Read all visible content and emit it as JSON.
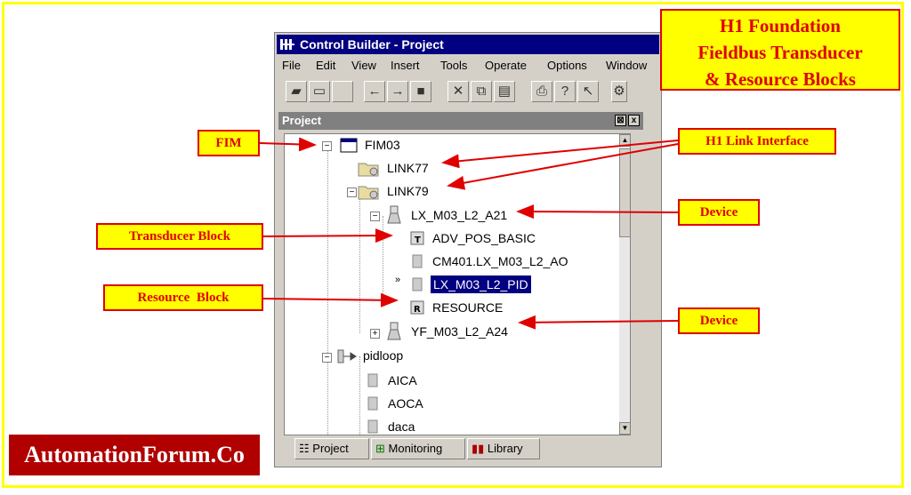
{
  "window": {
    "title": "Control Builder - Project",
    "menu": [
      "File",
      "Edit",
      "View",
      "Insert",
      "Tools",
      "Operate",
      "Options",
      "Window"
    ]
  },
  "panel": {
    "title": "Project",
    "pin_button": "⊠",
    "close_button": "x"
  },
  "tree": [
    {
      "label": "FIM03",
      "expander": "−",
      "icon": "fim-icon"
    },
    {
      "label": "LINK77",
      "expander": "",
      "icon": "link-folder-icon"
    },
    {
      "label": "LINK79",
      "expander": "−",
      "icon": "link-folder-icon"
    },
    {
      "label": "LX_M03_L2_A21",
      "expander": "−",
      "icon": "device-icon"
    },
    {
      "label": "ADV_POS_BASIC",
      "expander": "",
      "icon": "transducer-block-icon",
      "badge": "T"
    },
    {
      "label": "CM401.LX_M03_L2_AO",
      "expander": "",
      "icon": "block-icon"
    },
    {
      "label": "LX_M03_L2_PID",
      "expander": "",
      "icon": "block-icon",
      "selected": true
    },
    {
      "label": "RESOURCE",
      "expander": "",
      "icon": "resource-block-icon",
      "badge": "R"
    },
    {
      "label": "YF_M03_L2_A24",
      "expander": "+",
      "icon": "device-icon"
    },
    {
      "label": "pidloop",
      "expander": "−",
      "icon": "pidloop-icon"
    },
    {
      "label": "AICA",
      "expander": "",
      "icon": "block-icon"
    },
    {
      "label": "AOCA",
      "expander": "",
      "icon": "block-icon"
    },
    {
      "label": "daca",
      "expander": "",
      "icon": "block-icon"
    }
  ],
  "tabs": [
    {
      "label": "Project",
      "icon": "project-tab-icon"
    },
    {
      "label": "Monitoring",
      "icon": "monitoring-tab-icon"
    },
    {
      "label": "Library",
      "icon": "library-tab-icon"
    }
  ],
  "annotations": {
    "title": "H1 Foundation Fieldbus Transducer & Resource Blocks",
    "title_lines": [
      "H1 Foundation",
      "Fieldbus Transducer",
      "& Resource Blocks"
    ],
    "fim": "FIM",
    "h1_link": "H1 Link Interface",
    "device_1": "Device",
    "device_2": "Device",
    "transducer": "Transducer Block",
    "resource": "Resource  Block"
  },
  "brand": "AutomationForum.Co",
  "colors": {
    "label_fill": "#ffff00",
    "label_border": "#e00000",
    "arrow": "#e00000",
    "brand_bg": "#b00000",
    "title_bar": "#000080"
  }
}
